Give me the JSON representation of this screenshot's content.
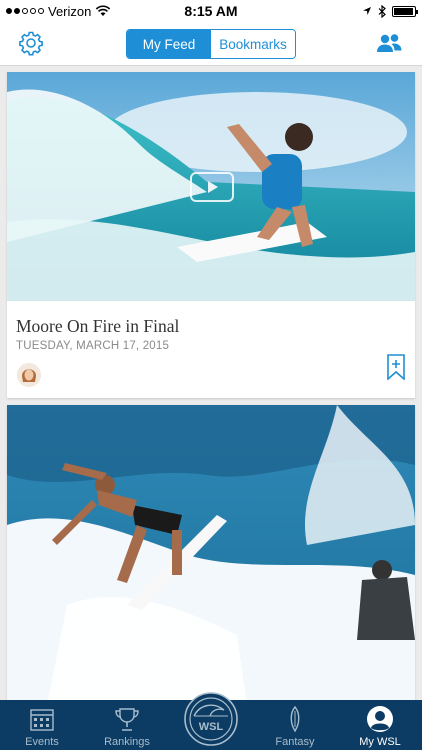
{
  "status_bar": {
    "carrier": "Verizon",
    "time": "8:15 AM",
    "signal_bars_filled": 2,
    "signal_bars_total": 5,
    "battery_level": 0.95
  },
  "nav": {
    "segments": [
      {
        "label": "My Feed",
        "active": true
      },
      {
        "label": "Bookmarks",
        "active": false
      }
    ],
    "left_icon": "gear-icon",
    "right_icon": "people-icon"
  },
  "feed": [
    {
      "title": "Moore On Fire in Final",
      "date": "TUESDAY, MARCH 17, 2015",
      "has_video": true,
      "image": "surfer-woman-blue-wave"
    },
    {
      "image": "surfer-man-white-wave"
    }
  ],
  "tabs": [
    {
      "label": "Events",
      "icon": "calendar-icon",
      "active": false
    },
    {
      "label": "Rankings",
      "icon": "trophy-icon",
      "active": false
    },
    {
      "label": "WSL",
      "icon": "wsl-logo-icon",
      "active": false
    },
    {
      "label": "Fantasy",
      "icon": "surfboard-icon",
      "active": false
    },
    {
      "label": "My WSL",
      "icon": "profile-icon",
      "active": true
    }
  ],
  "colors": {
    "accent": "#1e8fd6",
    "tab_bar": "#0c3c63"
  }
}
